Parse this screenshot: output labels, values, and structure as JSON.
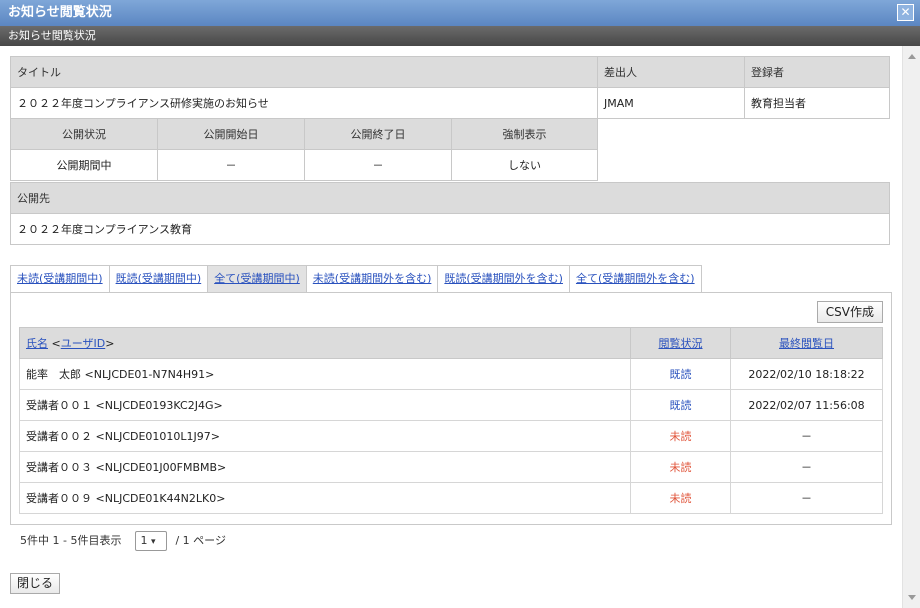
{
  "window": {
    "title": "お知らせ閲覧状況",
    "subtitle": "お知らせ閲覧状況",
    "close_icon": "close-icon"
  },
  "info": {
    "title_label": "タイトル",
    "title_value": "２０２２年度コンプライアンス研修実施のお知らせ",
    "sender_label": "差出人",
    "sender_value": "JMAM",
    "registrant_label": "登録者",
    "registrant_value": "教育担当者",
    "status_label": "公開状況",
    "status_value": "公開期間中",
    "start_label": "公開開始日",
    "start_value": "－",
    "end_label": "公開終了日",
    "end_value": "－",
    "force_label": "強制表示",
    "force_value": "しない",
    "target_label": "公開先",
    "target_value": "２０２２年度コンプライアンス教育"
  },
  "tabs": [
    "未読(受講期間中)",
    "既読(受講期間中)",
    "全て(受講期間中)",
    "未読(受講期間外を含む)",
    "既読(受講期間外を含む)",
    "全て(受講期間外を含む)"
  ],
  "csv_button": "CSV作成",
  "table": {
    "col_name": "氏名",
    "col_userid": "ユーザID",
    "col_status": "閲覧状況",
    "col_date": "最終閲覧日",
    "rows": [
      {
        "name": "能率　太郎 <NLJCDE01-N7N4H91>",
        "status": "既読",
        "date": "2022/02/10 18:18:22"
      },
      {
        "name": "受講者００１ <NLJCDE0193KC2J4G>",
        "status": "既読",
        "date": "2022/02/07 11:56:08"
      },
      {
        "name": "受講者００２ <NLJCDE01010L1J97>",
        "status": "未読",
        "date": "－"
      },
      {
        "name": "受講者００３ <NLJCDE01J00FMBMB>",
        "status": "未読",
        "date": "－"
      },
      {
        "name": "受講者００９ <NLJCDE01K44N2LK0>",
        "status": "未読",
        "date": "－"
      }
    ]
  },
  "pager": {
    "summary": "5件中 1 - 5件目表示",
    "page": "1",
    "total": "/ 1 ページ"
  },
  "close_button": "閉じる",
  "colors": {
    "read": "#2a52be",
    "unread": "#e0543a",
    "titlebar": "#5b86c2"
  }
}
